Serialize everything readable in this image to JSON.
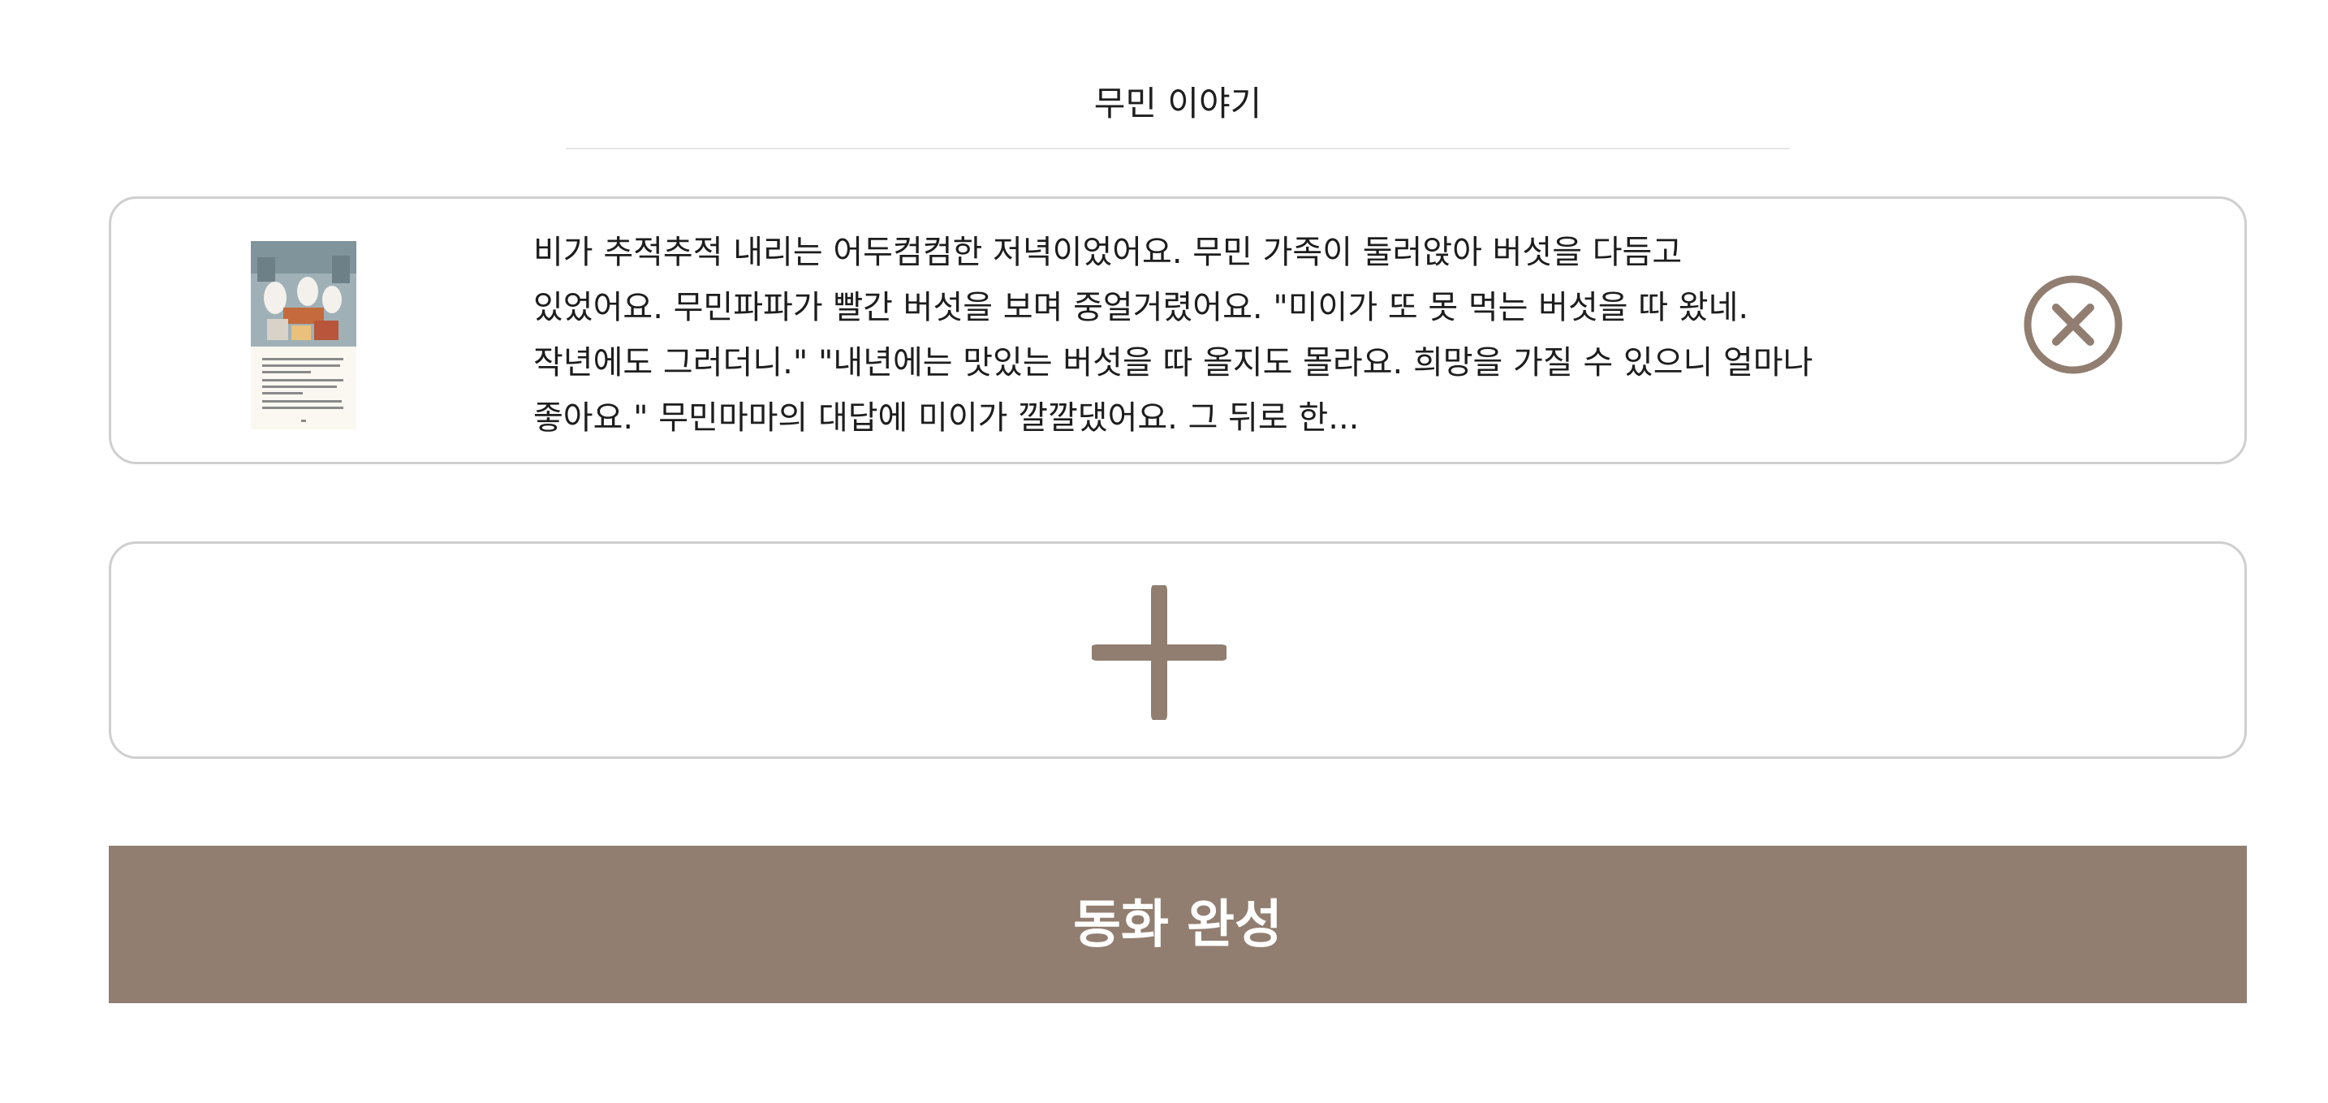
{
  "header": {
    "title": "무민 이야기"
  },
  "story_card": {
    "text": "비가 추적추적 내리는 어두컴컴한 저녁이었어요. 무민 가족이 둘러앉아 버섯을 다듬고 있었어요. 무민파파가 빨간 버섯을 보며 중얼거렸어요. \"미이가 또 못 먹는 버섯을 따 왔네. 작년에도 그러더니.\" \"내년에는 맛있는 버섯을 따 올지도 몰라요. 희망을 가질 수 있으니 얼마나 좋아요.\" 무민마마의 대답에 미이가 깔깔댔어요. 그 뒤로 한...",
    "thumbnail_icon": "storybook-page-thumbnail",
    "remove_icon": "close-circle-icon"
  },
  "add_card": {
    "icon": "plus-icon"
  },
  "footer": {
    "complete_label": "동화 완성"
  },
  "colors": {
    "accent": "#917e70",
    "card_border": "#cfcfcf",
    "divider": "#e6e6e6",
    "text": "#1d1d1d"
  }
}
